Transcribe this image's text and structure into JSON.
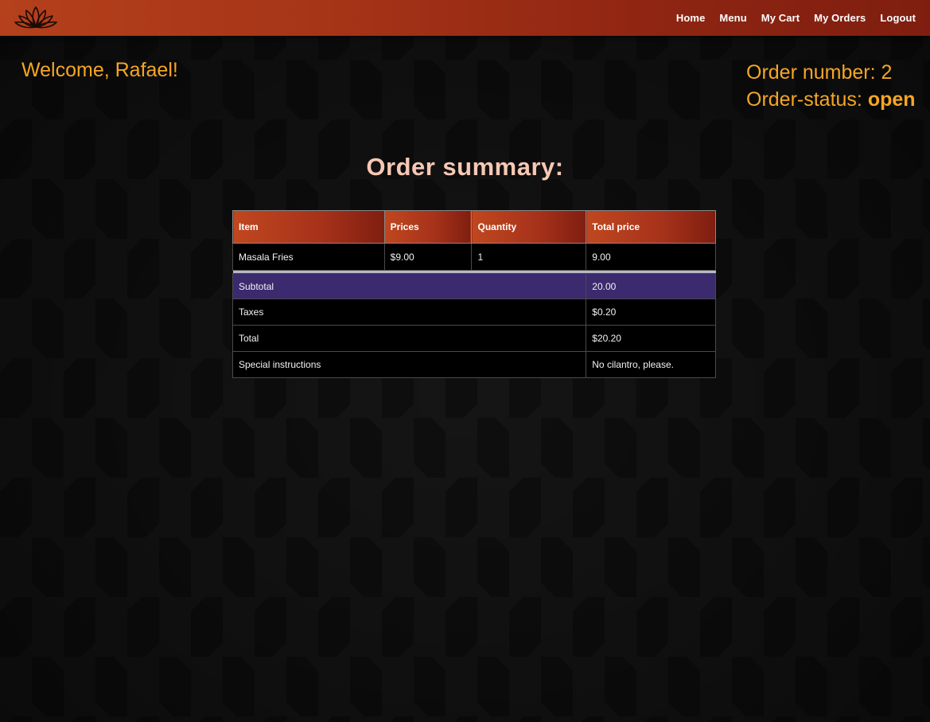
{
  "navbar": {
    "logo_icon": "lotus-logo-icon",
    "links": [
      "Home",
      "Menu",
      "My Cart",
      "My Orders",
      "Logout"
    ]
  },
  "welcome": "Welcome, Rafael!",
  "order": {
    "number_label": "Order number: 2",
    "status_label": "Order-status: ",
    "status_value": "open"
  },
  "summary_title": "Order summary:",
  "table": {
    "headers": [
      "Item",
      "Prices",
      "Quantity",
      "Total price"
    ],
    "items": [
      {
        "item": "Masala Fries",
        "price": "$9.00",
        "quantity": "1",
        "total": "9.00"
      }
    ],
    "subtotal_label": "Subtotal",
    "subtotal_value": "20.00",
    "taxes_label": "Taxes",
    "taxes_value": "$0.20",
    "total_label": "Total",
    "total_value": "$20.20",
    "instructions_label": "Special instructions",
    "instructions_value": "No cilantro, please."
  },
  "colors": {
    "accent": "#f5a623",
    "navbar_start": "#b4401c",
    "navbar_end": "#7f1e10",
    "subtotal_bg": "#3b2a6e",
    "title": "#f7c8b4"
  }
}
